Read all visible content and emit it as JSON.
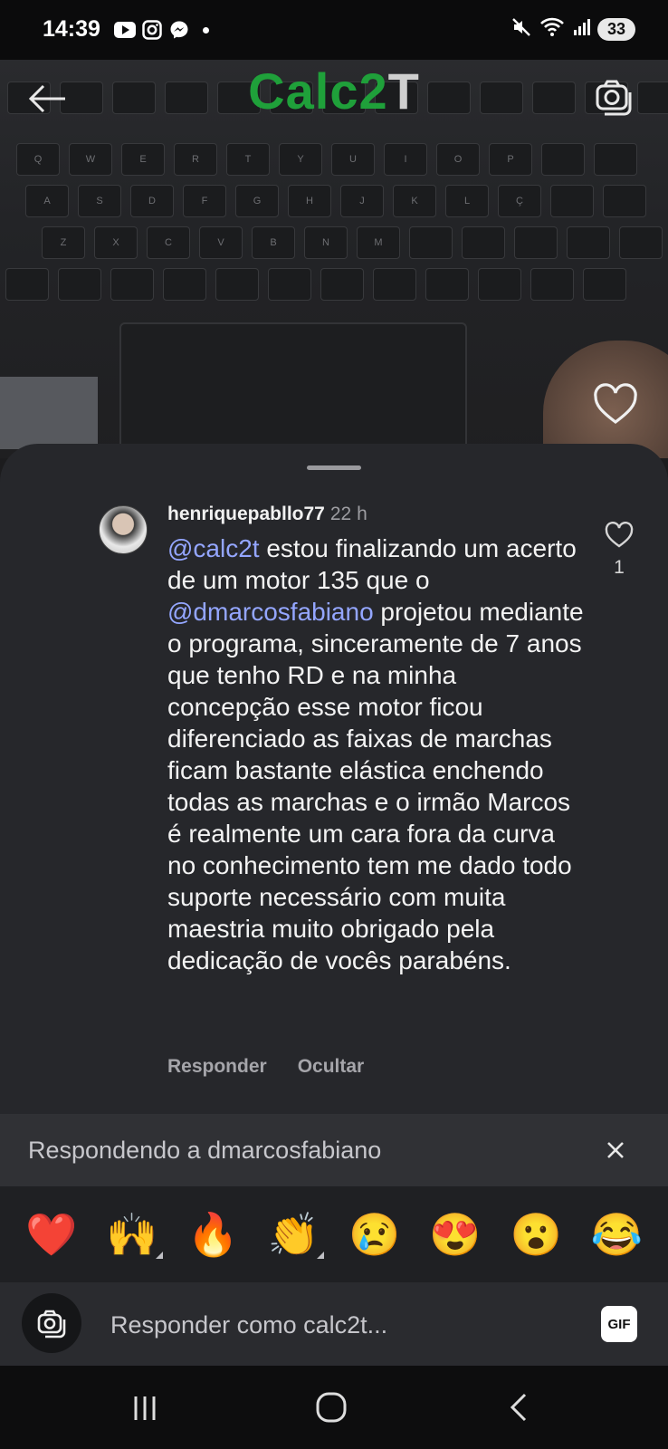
{
  "status_bar": {
    "time": "14:39",
    "battery": "33",
    "icons": [
      "youtube-icon",
      "instagram-icon",
      "messenger-icon",
      "notification-dot",
      "mute-icon",
      "wifi-icon",
      "signal-icon",
      "battery-icon"
    ]
  },
  "media": {
    "brand_green": "Calc2",
    "brand_white": "T",
    "keys_row1": [
      "Q",
      "W",
      "E",
      "R",
      "T",
      "Y",
      "U",
      "I",
      "O",
      "P"
    ],
    "keys_row2": [
      "A",
      "S",
      "D",
      "F",
      "G",
      "H",
      "J",
      "K",
      "L",
      "Ç"
    ],
    "keys_row3": [
      "Z",
      "X",
      "C",
      "V",
      "B",
      "N",
      "M"
    ]
  },
  "comment": {
    "username": "henriquepabllo77",
    "time": "22 h",
    "mention1": "@calc2t",
    "text1": " estou finalizando um acerto de um motor 135 que o ",
    "mention2": "@dmarcosfabiano",
    "text2": " projetou mediante o programa, sinceramente de 7 anos que tenho RD e na minha concepção esse motor ficou diferenciado as faixas de marchas ficam bastante elástica enchendo todas as marchas e o irmão Marcos é realmente um cara fora da curva no conhecimento tem me dado todo suporte necessário com muita maestria muito obrigado pela dedicação de vocês parabéns.",
    "like_count": "1",
    "reply_label": "Responder",
    "hide_label": "Ocultar"
  },
  "reply_bar": {
    "text": "Respondendo a dmarcosfabiano"
  },
  "emojis": [
    "❤️",
    "🙌",
    "🔥",
    "👏",
    "😢",
    "😍",
    "😮",
    "😂"
  ],
  "input": {
    "placeholder": "Responder como calc2t...",
    "gif_label": "GIF"
  },
  "colors": {
    "brand_green": "#1fa03a",
    "mention": "#94a6ff",
    "sheet_bg": "#26272b"
  }
}
